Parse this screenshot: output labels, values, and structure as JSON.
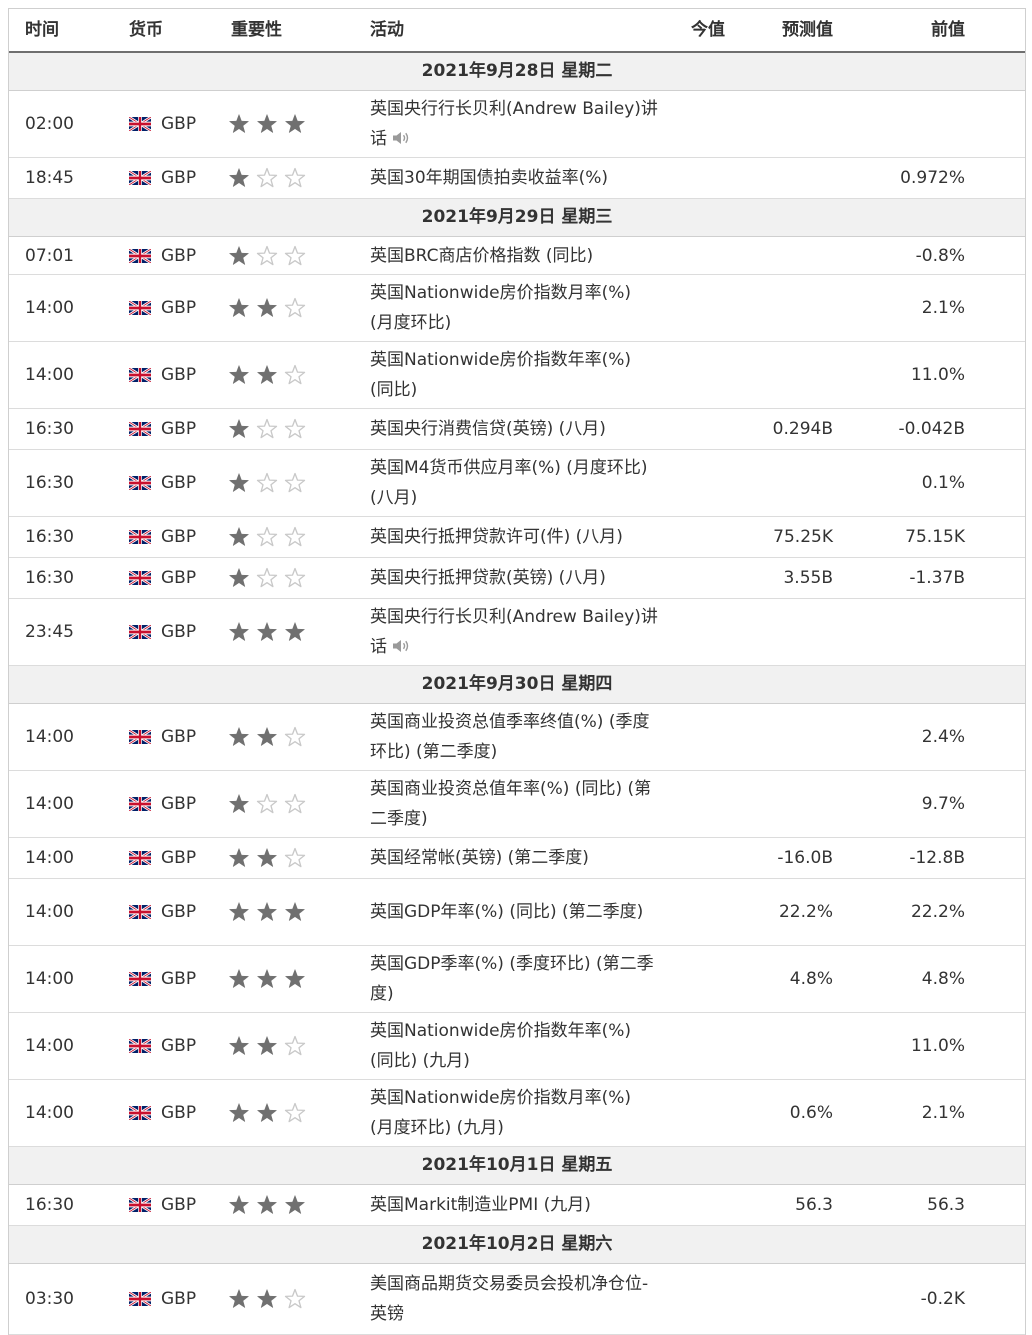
{
  "header": {
    "time": "时间",
    "currency": "货币",
    "importance": "重要性",
    "event": "活动",
    "actual": "今值",
    "forecast": "预测值",
    "previous": "前值"
  },
  "colors": {
    "star_filled": "#707070",
    "star_empty": "#c8c8c8",
    "day_bg": "#f1f1f1",
    "border": "#cfcfcf",
    "flag_red": "#c8102e",
    "flag_blue": "#012169"
  },
  "days": [
    {
      "label": "2021年9月28日 星期二",
      "events": [
        {
          "time": "02:00",
          "currency": "GBP",
          "importance": 3,
          "name": "英国央行行长贝利(Andrew Bailey)讲话",
          "speech": true,
          "actual": "",
          "forecast": "",
          "previous": ""
        },
        {
          "time": "18:45",
          "currency": "GBP",
          "importance": 1,
          "name": "英国30年期国债拍卖收益率(%)",
          "speech": false,
          "actual": "",
          "forecast": "",
          "previous": "0.972%"
        }
      ]
    },
    {
      "label": "2021年9月29日 星期三",
      "events": [
        {
          "time": "07:01",
          "currency": "GBP",
          "importance": 1,
          "name": "英国BRC商店价格指数 (同比)",
          "speech": false,
          "actual": "",
          "forecast": "",
          "previous": "-0.8%"
        },
        {
          "time": "14:00",
          "currency": "GBP",
          "importance": 2,
          "name": "英国Nationwide房价指数月率(%) (月度环比)",
          "speech": false,
          "actual": "",
          "forecast": "",
          "previous": "2.1%"
        },
        {
          "time": "14:00",
          "currency": "GBP",
          "importance": 2,
          "name": "英国Nationwide房价指数年率(%) (同比)",
          "speech": false,
          "actual": "",
          "forecast": "",
          "previous": "11.0%"
        },
        {
          "time": "16:30",
          "currency": "GBP",
          "importance": 1,
          "name": "英国央行消费信贷(英镑) (八月)",
          "speech": false,
          "actual": "",
          "forecast": "0.294B",
          "previous": "-0.042B"
        },
        {
          "time": "16:30",
          "currency": "GBP",
          "importance": 1,
          "name": "英国M4货币供应月率(%) (月度环比) (八月)",
          "speech": false,
          "actual": "",
          "forecast": "",
          "previous": "0.1%"
        },
        {
          "time": "16:30",
          "currency": "GBP",
          "importance": 1,
          "name": "英国央行抵押贷款许可(件) (八月)",
          "speech": false,
          "actual": "",
          "forecast": "75.25K",
          "previous": "75.15K"
        },
        {
          "time": "16:30",
          "currency": "GBP",
          "importance": 1,
          "name": "英国央行抵押贷款(英镑) (八月)",
          "speech": false,
          "actual": "",
          "forecast": "3.55B",
          "previous": "-1.37B"
        },
        {
          "time": "23:45",
          "currency": "GBP",
          "importance": 3,
          "name": "英国央行行长贝利(Andrew Bailey)讲话",
          "speech": true,
          "actual": "",
          "forecast": "",
          "previous": ""
        }
      ]
    },
    {
      "label": "2021年9月30日 星期四",
      "events": [
        {
          "time": "14:00",
          "currency": "GBP",
          "importance": 2,
          "name": "英国商业投资总值季率终值(%) (季度环比) (第二季度)",
          "speech": false,
          "actual": "",
          "forecast": "",
          "previous": "2.4%"
        },
        {
          "time": "14:00",
          "currency": "GBP",
          "importance": 1,
          "name": "英国商业投资总值年率(%) (同比) (第二季度)",
          "speech": false,
          "actual": "",
          "forecast": "",
          "previous": "9.7%"
        },
        {
          "time": "14:00",
          "currency": "GBP",
          "importance": 2,
          "name": "英国经常帐(英镑) (第二季度)",
          "speech": false,
          "actual": "",
          "forecast": "-16.0B",
          "previous": "-12.8B"
        },
        {
          "time": "14:00",
          "currency": "GBP",
          "importance": 3,
          "name": "英国GDP年率(%) (同比) (第二季度)",
          "speech": false,
          "actual": "",
          "forecast": "22.2%",
          "previous": "22.2%"
        },
        {
          "time": "14:00",
          "currency": "GBP",
          "importance": 3,
          "name": "英国GDP季率(%) (季度环比) (第二季度)",
          "speech": false,
          "actual": "",
          "forecast": "4.8%",
          "previous": "4.8%"
        },
        {
          "time": "14:00",
          "currency": "GBP",
          "importance": 2,
          "name": "英国Nationwide房价指数年率(%) (同比) (九月)",
          "speech": false,
          "actual": "",
          "forecast": "",
          "previous": "11.0%"
        },
        {
          "time": "14:00",
          "currency": "GBP",
          "importance": 2,
          "name": "英国Nationwide房价指数月率(%) (月度环比) (九月)",
          "speech": false,
          "actual": "",
          "forecast": "0.6%",
          "previous": "2.1%"
        }
      ]
    },
    {
      "label": "2021年10月1日 星期五",
      "events": [
        {
          "time": "16:30",
          "currency": "GBP",
          "importance": 3,
          "name": "英国Markit制造业PMI (九月)",
          "speech": false,
          "actual": "",
          "forecast": "56.3",
          "previous": "56.3"
        }
      ]
    },
    {
      "label": "2021年10月2日 星期六",
      "events": [
        {
          "time": "03:30",
          "currency": "GBP",
          "importance": 2,
          "name": "美国商品期货交易委员会投机净仓位-英镑",
          "speech": false,
          "actual": "",
          "forecast": "",
          "previous": "-0.2K"
        }
      ]
    }
  ]
}
